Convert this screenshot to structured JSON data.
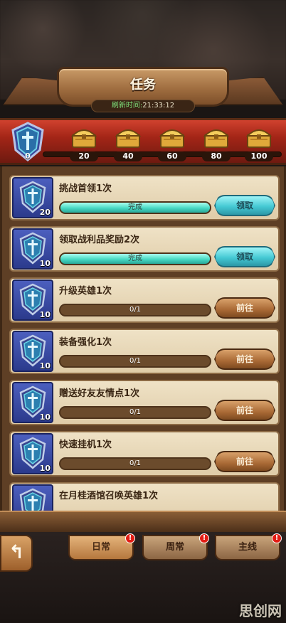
{
  "header": {
    "title": "任务",
    "refresh_label": "刷新时间:",
    "refresh_time": "21:33:12"
  },
  "reward_track": {
    "current_points": "0",
    "chests": [
      "20",
      "40",
      "60",
      "80",
      "100"
    ]
  },
  "tasks": [
    {
      "name": "挑战首领1次",
      "points": "20",
      "progress_text": "完成",
      "progress": 1.0,
      "button": "领取",
      "status": "claim"
    },
    {
      "name": "领取战利品奖励2次",
      "points": "10",
      "progress_text": "完成",
      "progress": 1.0,
      "button": "领取",
      "status": "claim"
    },
    {
      "name": "升级英雄1次",
      "points": "10",
      "progress_text": "0/1",
      "progress": 0.0,
      "button": "前往",
      "status": "go"
    },
    {
      "name": "装备强化1次",
      "points": "10",
      "progress_text": "0/1",
      "progress": 0.0,
      "button": "前往",
      "status": "go"
    },
    {
      "name": "赠送好友友情点1次",
      "points": "10",
      "progress_text": "0/1",
      "progress": 0.0,
      "button": "前往",
      "status": "go"
    },
    {
      "name": "快速挂机1次",
      "points": "10",
      "progress_text": "0/1",
      "progress": 0.0,
      "button": "前往",
      "status": "go"
    },
    {
      "name": "在月桂酒馆召唤英雄1次",
      "points": "",
      "progress_text": "",
      "progress": 0.0,
      "button": "",
      "status": "go"
    }
  ],
  "tabs": [
    {
      "label": "日常",
      "badge": "!"
    },
    {
      "label": "周常",
      "badge": "!"
    },
    {
      "label": "主线",
      "badge": "!"
    }
  ],
  "back_icon": "back-arrow-icon",
  "watermark": "思创网",
  "colors": {
    "claim_button": "#45c9d4",
    "go_button": "#a96935",
    "progress_fill": "#47d8c3",
    "track": "#a32517",
    "badge": "#e21c14"
  }
}
